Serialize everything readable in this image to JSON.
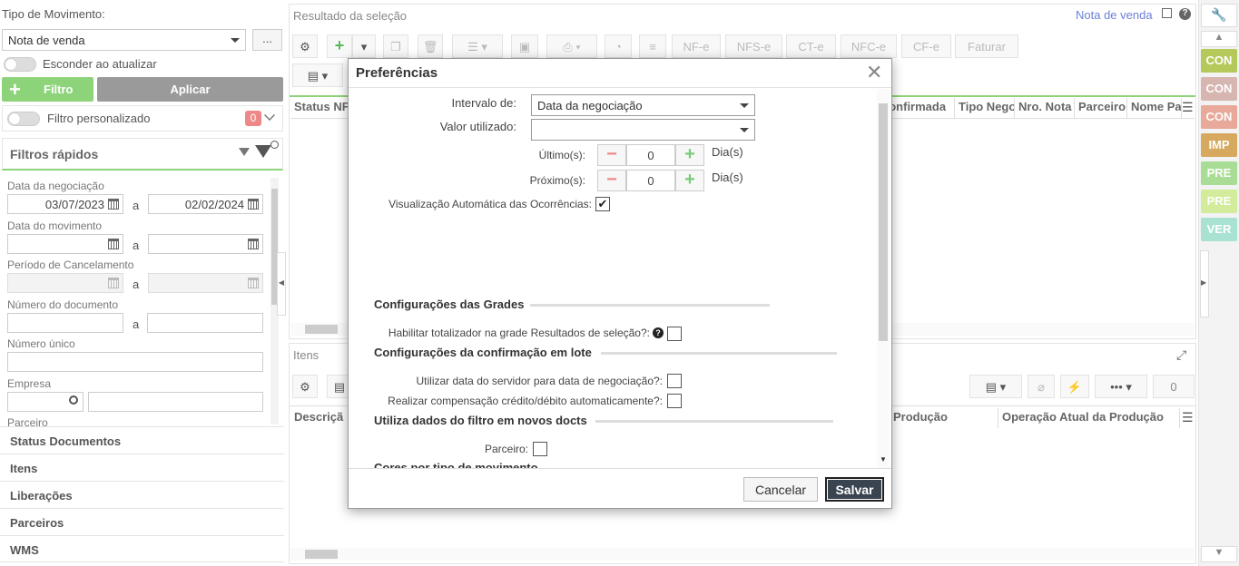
{
  "left": {
    "tipo_label": "Tipo de Movimento:",
    "tipo_value": "Nota de venda",
    "more_label": "...",
    "esconder_label": "Esconder ao atualizar",
    "filtro_label": "Filtro",
    "aplicar_label": "Aplicar",
    "filtro_pers_label": "Filtro personalizado",
    "filtro_pers_count": "0",
    "filtros_rapidos": "Filtros rápidos",
    "data_negociacao": "Data da negociação",
    "data_from": "03/07/2023",
    "data_to": "02/02/2024",
    "a": "a",
    "data_movimento": "Data do movimento",
    "periodo_cancel": "Período de Cancelamento",
    "numero_doc": "Número do documento",
    "numero_unico": "Número único",
    "empresa": "Empresa",
    "parceiro": "Parceiro",
    "sections": [
      "Status Documentos",
      "Itens",
      "Liberações",
      "Parceiros",
      "WMS"
    ]
  },
  "main": {
    "title": "Resultado da seleção",
    "nota_link": "Nota de venda",
    "toolbar_buttons": [
      "NF-e",
      "NFS-e",
      "CT-e",
      "NFC-e",
      "CF-e",
      "Faturar"
    ],
    "columns": [
      "Status NF",
      "confirmada",
      "Tipo Nego",
      "Nro. Nota",
      "Parceiro",
      "Nome Pa"
    ],
    "itens_title": "Itens",
    "itens_columns": [
      "Descriçã",
      "Produção",
      "Operação Atual da Produção"
    ],
    "itens_count": "0"
  },
  "tags": [
    {
      "label": "CON",
      "color": "#b5c95a"
    },
    {
      "label": "CON",
      "color": "#d7b5b0"
    },
    {
      "label": "CON",
      "color": "#e8a99a"
    },
    {
      "label": "IMP",
      "color": "#d6a95e"
    },
    {
      "label": "PRE",
      "color": "#a9dd96"
    },
    {
      "label": "PRE",
      "color": "#d2ec9c"
    },
    {
      "label": "VER",
      "color": "#a9e2d2"
    }
  ],
  "modal": {
    "title": "Preferências",
    "intervalo_label": "Intervalo de:",
    "intervalo_value": "Data da negociação",
    "valor_label": "Valor utilizado:",
    "valor_value": "",
    "ultimos_label": "Último(s):",
    "ultimos_value": "0",
    "proximos_label": "Próximo(s):",
    "proximos_value": "0",
    "dias_label": "Dia(s)",
    "visualizacao_label": "Visualização Automática das Ocorrências:",
    "grades_title": "Configurações das Grades",
    "totalizador_label": "Habilitar totalizador na grade Resultados de seleção?:",
    "confirmacao_title": "Configurações da confirmação em lote",
    "data_servidor_label": "Utilizar data do servidor para data de negociação?:",
    "compensacao_label": "Realizar compensação crédito/débito automaticamente?:",
    "filtro_docts_title": "Utiliza dados do filtro em novos docts",
    "parceiro_label": "Parceiro:",
    "cores_title": "Cores por tipo de movimento",
    "cancel_label": "Cancelar",
    "save_label": "Salvar"
  }
}
